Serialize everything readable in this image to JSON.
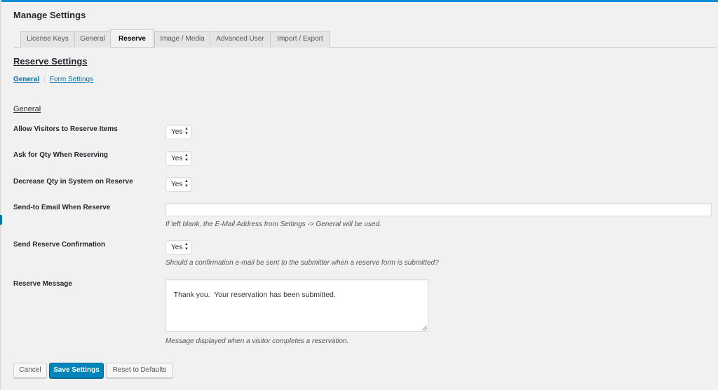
{
  "page": {
    "title": "Manage Settings"
  },
  "tabs": [
    {
      "label": "License Keys"
    },
    {
      "label": "General"
    },
    {
      "label": "Reserve"
    },
    {
      "label": "Image / Media"
    },
    {
      "label": "Advanced User"
    },
    {
      "label": "Import / Export"
    }
  ],
  "active_tab": "Reserve",
  "section": {
    "title": "Reserve Settings"
  },
  "subnav": {
    "general": "General",
    "separator": "|",
    "form_settings": "Form Settings"
  },
  "group": {
    "title": "General"
  },
  "fields": {
    "allow_visitors": {
      "label": "Allow Visitors to Reserve Items",
      "value": "Yes"
    },
    "ask_qty": {
      "label": "Ask for Qty When Reserving",
      "value": "Yes"
    },
    "decrease_qty": {
      "label": "Decrease Qty in System on Reserve",
      "value": "Yes"
    },
    "send_to_email": {
      "label": "Send-to Email When Reserve",
      "value": "",
      "description": "If left blank, the E-Mail Address from Settings -> General will be used."
    },
    "send_confirmation": {
      "label": "Send Reserve Confirmation",
      "value": "Yes",
      "description": "Should a confirmation e-mail be sent to the submitter when a reserve form is submitted?"
    },
    "reserve_message": {
      "label": "Reserve Message",
      "value": "Thank you.  Your reservation has been submitted.",
      "description": "Message displayed when a visitor completes a reservation."
    }
  },
  "buttons": {
    "cancel": "Cancel",
    "save": "Save Settings",
    "reset": "Reset to Defaults"
  },
  "icons": {
    "select_arrows": "up-down-arrows-icon",
    "resize": "resize-grip-icon"
  },
  "colors": {
    "accent": "#0085ba",
    "top_bar": "#0a8ed6",
    "link": "#0073aa"
  }
}
